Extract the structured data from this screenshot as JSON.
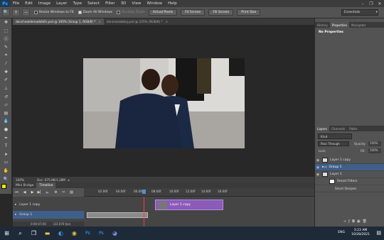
{
  "app": {
    "logo": "Ps"
  },
  "menu": [
    "File",
    "Edit",
    "Image",
    "Layer",
    "Type",
    "Select",
    "Filter",
    "3D",
    "View",
    "Window",
    "Help"
  ],
  "window_controls": [
    "–",
    "❐",
    "✕"
  ],
  "options": {
    "resize_windows": "Resize Windows to Fit",
    "zoom_all": "Zoom All Windows",
    "scrubby_zoom": "Scrubby Zoom",
    "actual_pixels": "Actual Pixels",
    "fit_screen": "Fit Screen",
    "fill_screen": "Fill Screen",
    "print_size": "Print Size",
    "workspace": "Essentials"
  },
  "tabs": [
    {
      "label": "donchealdemadelbfn.psd @ 100% (Group 1, RGB/8) *"
    },
    {
      "label": "donmeadebluj.psd @ 225% (RGB/8) *"
    }
  ],
  "status": {
    "zoom": "100%",
    "doc": "Doc: 675.8K/1.28M"
  },
  "timeline": {
    "tabs": [
      "Mini Bridge",
      "Timeline"
    ],
    "ticks": [
      "02:00f",
      "04:00f",
      "06:00f",
      "08:00f",
      "10:00f",
      "12:00f",
      "14:00f",
      "16:00f"
    ],
    "tracks": [
      {
        "label": "Layer 1 copy"
      },
      {
        "label": "Group 1"
      }
    ],
    "clip_label": "Layer 1 copy",
    "time": "0:00:07:00",
    "fps": "(22.076 fps)"
  },
  "properties": {
    "tabs": [
      "History",
      "Properties",
      "Navigator"
    ],
    "empty": "No Properties"
  },
  "layers": {
    "tabs": [
      "Layers",
      "Channels",
      "Paths"
    ],
    "filter": "Kind",
    "blend_mode": "Pass Through",
    "opacity_label": "Opacity:",
    "opacity": "100%",
    "lock_label": "Lock:",
    "fill_label": "Fill:",
    "fill": "100%",
    "items": [
      {
        "name": "Layer 1 copy"
      },
      {
        "name": "Group 1"
      },
      {
        "name": "Layer 1"
      },
      {
        "name": "Smart Filters"
      },
      {
        "name": "Smart Sharpen"
      }
    ]
  },
  "taskbar": {
    "time": "3:23 AM",
    "date": "10/28/2021",
    "lang": "ENG",
    "icons": [
      "windows-icon",
      "search-icon",
      "task-view-icon",
      "file-explorer-icon",
      "edge-icon",
      "chrome-icon",
      "photoshop-icon",
      "photoshop-icon",
      "discord-icon"
    ]
  },
  "colors": {
    "accent": "#31a8ff",
    "clip": "#8b5bb8",
    "selection": "#3e5f8a",
    "foreground_swatch": "#f5e600"
  }
}
